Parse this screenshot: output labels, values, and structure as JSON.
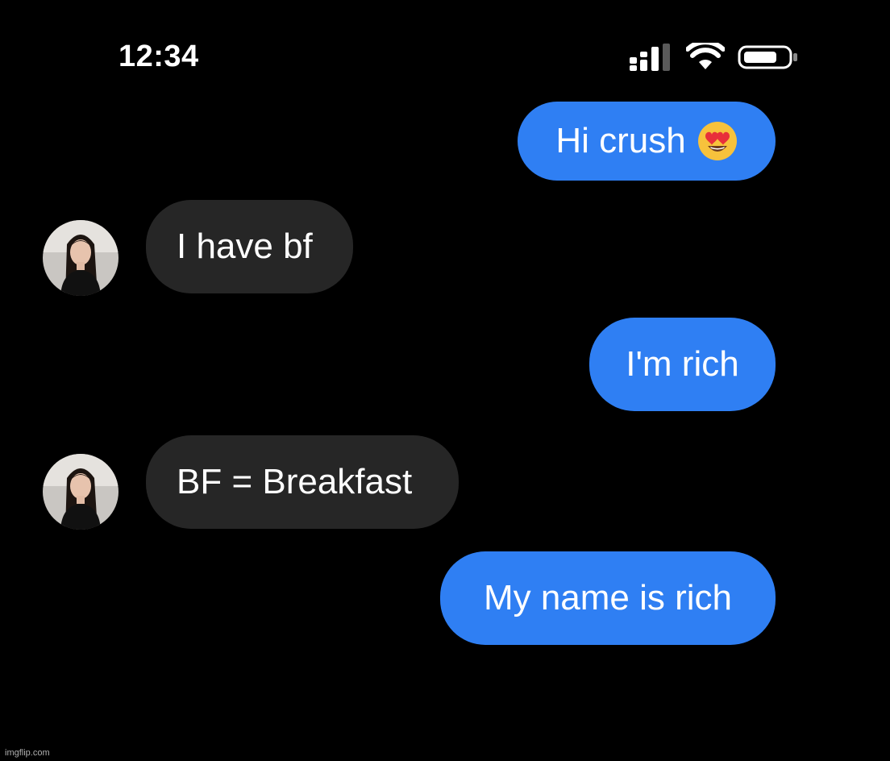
{
  "status_bar": {
    "time": "12:34"
  },
  "icons": {
    "signal": "signal-bars-icon",
    "wifi": "wifi-icon",
    "battery": "battery-icon",
    "emoji": "heart-eyes-emoji-icon"
  },
  "colors": {
    "outgoing_bubble": "#2f7ff3",
    "incoming_bubble": "#262626",
    "background": "#000000"
  },
  "messages": [
    {
      "direction": "outgoing",
      "text": "Hi crush",
      "emoji": "heart-eyes"
    },
    {
      "direction": "incoming",
      "text": "I have bf"
    },
    {
      "direction": "outgoing",
      "text": "I'm rich"
    },
    {
      "direction": "incoming",
      "text": "BF = Breakfast"
    },
    {
      "direction": "outgoing",
      "text": "My name is rich"
    }
  ],
  "watermark": "imgflip.com"
}
